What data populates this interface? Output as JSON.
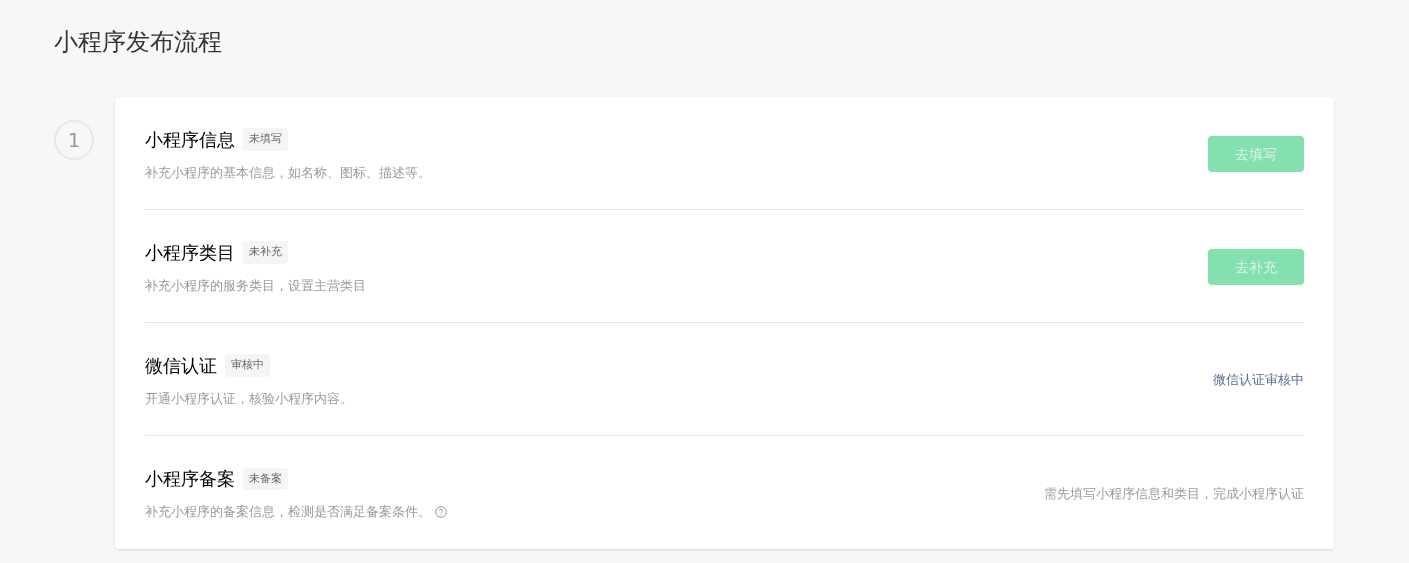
{
  "page_title": "小程序发布流程",
  "step": {
    "number": "1"
  },
  "tasks": [
    {
      "title": "小程序信息",
      "status": "未填写",
      "description": "补充小程序的基本信息，如名称、图标、描述等。",
      "help": false,
      "action": {
        "kind": "button",
        "label": "去填写",
        "disabled": true
      }
    },
    {
      "title": "小程序类目",
      "status": "未补充",
      "description": "补充小程序的服务类目，设置主营类目",
      "help": false,
      "action": {
        "kind": "button",
        "label": "去补充",
        "disabled": true
      }
    },
    {
      "title": "微信认证",
      "status": "审核中",
      "description": "开通小程序认证，核验小程序内容。",
      "help": false,
      "action": {
        "kind": "link",
        "label": "微信认证审核中"
      }
    },
    {
      "title": "小程序备案",
      "status": "未备案",
      "description": "补充小程序的备案信息，检测是否满足备案条件。",
      "help": true,
      "action": {
        "kind": "note",
        "label": "需先填写小程序信息和类目，完成小程序认证"
      }
    }
  ]
}
